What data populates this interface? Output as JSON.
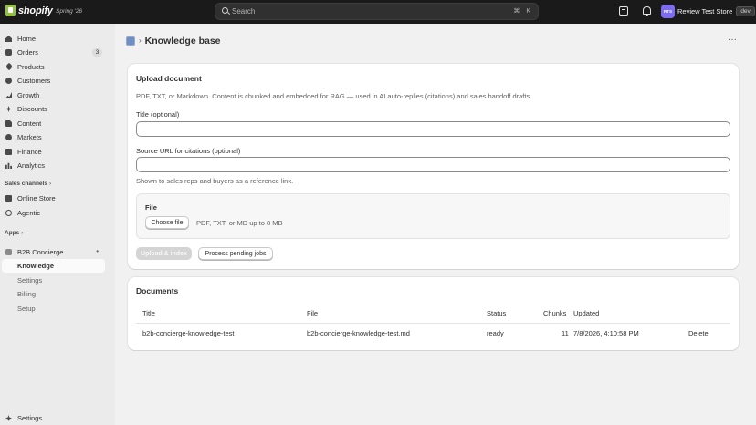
{
  "topbar": {
    "logo_text": "shopify",
    "edition": "Spring '26",
    "search_placeholder": "Search",
    "shortcut": "⌘ K",
    "avatar_initials": "RTS",
    "store_name": "Review Test Store",
    "dev_badge": "dev"
  },
  "sidebar": {
    "items": [
      {
        "label": "Home",
        "icon": "home-icon"
      },
      {
        "label": "Orders",
        "icon": "orders-icon",
        "count": "3"
      },
      {
        "label": "Products",
        "icon": "products-icon"
      },
      {
        "label": "Customers",
        "icon": "customers-icon"
      },
      {
        "label": "Growth",
        "icon": "growth-icon"
      },
      {
        "label": "Discounts",
        "icon": "discounts-icon"
      },
      {
        "label": "Content",
        "icon": "content-icon"
      },
      {
        "label": "Markets",
        "icon": "markets-icon"
      },
      {
        "label": "Finance",
        "icon": "finance-icon"
      },
      {
        "label": "Analytics",
        "icon": "analytics-icon"
      }
    ],
    "sales_channels_label": "Sales channels",
    "channels": [
      {
        "label": "Online Store",
        "icon": "online-store-icon"
      },
      {
        "label": "Agentic",
        "icon": "agentic-icon"
      }
    ],
    "apps_label": "Apps",
    "app_name": "B2B Concierge",
    "app_subitems": [
      "Knowledge",
      "Settings",
      "Billing",
      "Setup"
    ],
    "active_subitem": "Knowledge",
    "settings_label": "Settings"
  },
  "page": {
    "title": "Knowledge base",
    "more_label": "···"
  },
  "upload": {
    "title": "Upload document",
    "description": "PDF, TXT, or Markdown. Content is chunked and embedded for RAG — used in AI auto-replies (citations) and sales handoff drafts.",
    "title_field_label": "Title (optional)",
    "title_field_value": "",
    "source_field_label": "Source URL for citations (optional)",
    "source_field_value": "",
    "source_help": "Shown to sales reps and buyers as a reference link.",
    "file_label": "File",
    "choose_file_label": "Choose file",
    "file_hint": "PDF, TXT, or MD up to 8 MB",
    "upload_button_label": "Upload & index",
    "process_button_label": "Process pending jobs"
  },
  "documents": {
    "title": "Documents",
    "columns": [
      "Title",
      "File",
      "Status",
      "Chunks",
      "Updated"
    ],
    "rows": [
      {
        "title": "b2b-concierge-knowledge-test",
        "file": "b2b-concierge-knowledge-test.md",
        "status": "ready",
        "chunks": "11",
        "updated": "7/8/2026, 4:10:58 PM",
        "action": "Delete"
      }
    ]
  },
  "colors": {
    "topbar_bg": "#1a1a1a",
    "page_bg": "#f1f1f1",
    "sidebar_bg": "#ebebeb",
    "brand_green": "#95bf47",
    "avatar": "#7d6cf0"
  }
}
